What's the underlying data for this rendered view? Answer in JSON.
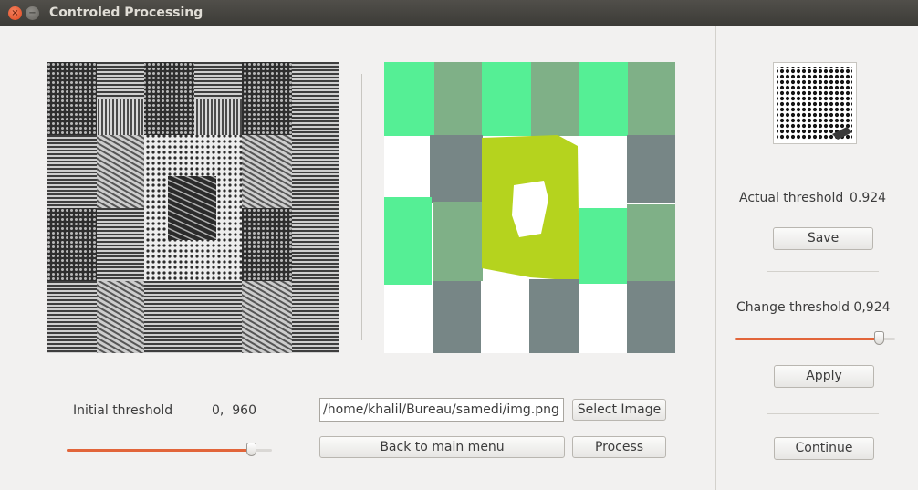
{
  "window": {
    "title": "Controled Processing",
    "close_glyph": "×",
    "minimize_glyph": "−"
  },
  "left": {
    "initial_threshold_label": "Initial threshold",
    "initial_threshold_value": "0,  960",
    "initial_threshold_slider": 0.92,
    "path_value": "/home/khalil/Bureau/samedi/img.png",
    "select_image_label": "Select Image",
    "back_label": "Back to main menu",
    "process_label": "Process"
  },
  "right": {
    "actual_threshold_label": "Actual threshold",
    "actual_threshold_value": "0.924",
    "save_label": "Save",
    "change_threshold_label": "Change threshold 0,924",
    "change_threshold_slider": 0.924,
    "apply_label": "Apply",
    "continue_label": "Continue"
  },
  "colors": {
    "accent": "#e2653a",
    "seg_green": "#55ef95",
    "seg_sage": "#7fb087",
    "seg_slate": "#778686",
    "seg_lime": "#b5d31e"
  }
}
